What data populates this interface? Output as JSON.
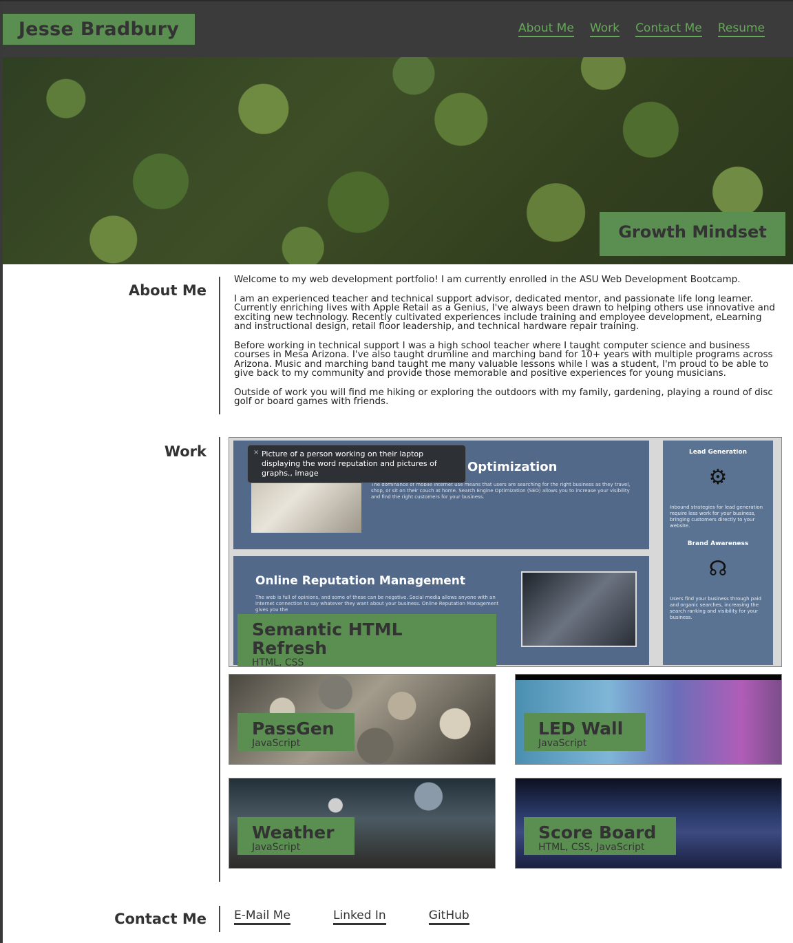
{
  "header": {
    "brand": "Jesse Bradbury",
    "nav": [
      "About Me",
      "Work",
      "Contact Me",
      "Resume"
    ]
  },
  "hero": {
    "badge": "Growth Mindset"
  },
  "about": {
    "title": "About Me",
    "paragraphs": [
      "Welcome to my web development portfolio! I am currently enrolled in the ASU Web Development Bootcamp.",
      "I am an experienced teacher and technical support advisor, dedicated mentor, and passionate life long learner. Currently enriching lives with Apple Retail as a Genius, I've always been drawn to helping others use innovative and exciting new technology. Recently cultivated experiences include training and employee development, eLearning and instructional design, retail floor leadership, and technical hardware repair training.",
      "Before working in technical support I was a high school teacher where I taught computer science and business courses in Mesa Arizona. I've also taught drumline and marching band for 10+ years with multiple programs across Arizona. Music and marching band taught me many valuable lessons while I was a student, I'm proud to be able to give back to my community and provide those memorable and positive experiences for young musicians.",
      "Outside of work you will find me hiking or exploring the outdoors with my family, gardening, playing a round of disc golf or board games with friends."
    ]
  },
  "work": {
    "title": "Work",
    "featured": {
      "title": "Semantic HTML Refresh",
      "tech": "HTML, CSS",
      "tooltip": "Picture of a person working on their laptop displaying the word reputation and pictures of graphs., image",
      "tooltip_close": "×",
      "screenshot": {
        "heading_top": "Optimization",
        "text_top": "The dominance of mobile internet use means that users are searching for the right business as they travel, shop, or sit on their couch at home. Search Engine Optimization (SEO) allows you to increase your visibility and find the right customers for your business.",
        "heading_bottom": "Online Reputation Management",
        "text_bottom": "The web is full of opinions, and some of these can be negative. Social media allows anyone with an internet connection to say whatever they want about your business. Online Reputation Management gives you the",
        "side_heading_1": "Lead Generation",
        "side_text_1": "Inbound strategies for lead generation require less work for your business, bringing customers directly to your website.",
        "side_heading_2": "Brand Awareness",
        "side_text_2": "Users find your business through paid and organic searches, increasing the search ranking and visibility for your business."
      }
    },
    "projects": [
      {
        "title": "PassGen",
        "tech": "JavaScript"
      },
      {
        "title": "LED Wall",
        "tech": "JavaScript"
      },
      {
        "title": "Weather",
        "tech": "JavaScript"
      },
      {
        "title": "Score Board",
        "tech": "HTML, CSS, JavaScript"
      }
    ]
  },
  "contact": {
    "title": "Contact Me",
    "links": [
      "E-Mail Me",
      "Linked In",
      "GitHub"
    ]
  },
  "colors": {
    "accent_green": "#5b8f51",
    "nav_green": "#64a859",
    "header_bg": "#3b3b3b"
  }
}
